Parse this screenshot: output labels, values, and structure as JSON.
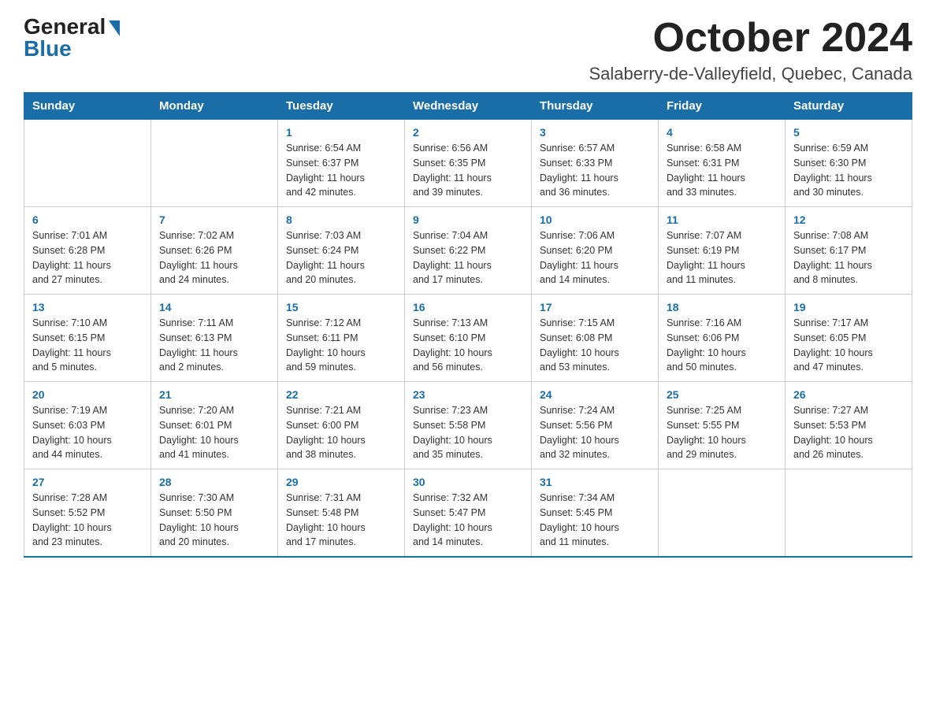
{
  "logo": {
    "general": "General",
    "blue": "Blue"
  },
  "header": {
    "month": "October 2024",
    "location": "Salaberry-de-Valleyfield, Quebec, Canada"
  },
  "weekdays": [
    "Sunday",
    "Monday",
    "Tuesday",
    "Wednesday",
    "Thursday",
    "Friday",
    "Saturday"
  ],
  "weeks": [
    [
      {
        "day": "",
        "info": ""
      },
      {
        "day": "",
        "info": ""
      },
      {
        "day": "1",
        "info": "Sunrise: 6:54 AM\nSunset: 6:37 PM\nDaylight: 11 hours\nand 42 minutes."
      },
      {
        "day": "2",
        "info": "Sunrise: 6:56 AM\nSunset: 6:35 PM\nDaylight: 11 hours\nand 39 minutes."
      },
      {
        "day": "3",
        "info": "Sunrise: 6:57 AM\nSunset: 6:33 PM\nDaylight: 11 hours\nand 36 minutes."
      },
      {
        "day": "4",
        "info": "Sunrise: 6:58 AM\nSunset: 6:31 PM\nDaylight: 11 hours\nand 33 minutes."
      },
      {
        "day": "5",
        "info": "Sunrise: 6:59 AM\nSunset: 6:30 PM\nDaylight: 11 hours\nand 30 minutes."
      }
    ],
    [
      {
        "day": "6",
        "info": "Sunrise: 7:01 AM\nSunset: 6:28 PM\nDaylight: 11 hours\nand 27 minutes."
      },
      {
        "day": "7",
        "info": "Sunrise: 7:02 AM\nSunset: 6:26 PM\nDaylight: 11 hours\nand 24 minutes."
      },
      {
        "day": "8",
        "info": "Sunrise: 7:03 AM\nSunset: 6:24 PM\nDaylight: 11 hours\nand 20 minutes."
      },
      {
        "day": "9",
        "info": "Sunrise: 7:04 AM\nSunset: 6:22 PM\nDaylight: 11 hours\nand 17 minutes."
      },
      {
        "day": "10",
        "info": "Sunrise: 7:06 AM\nSunset: 6:20 PM\nDaylight: 11 hours\nand 14 minutes."
      },
      {
        "day": "11",
        "info": "Sunrise: 7:07 AM\nSunset: 6:19 PM\nDaylight: 11 hours\nand 11 minutes."
      },
      {
        "day": "12",
        "info": "Sunrise: 7:08 AM\nSunset: 6:17 PM\nDaylight: 11 hours\nand 8 minutes."
      }
    ],
    [
      {
        "day": "13",
        "info": "Sunrise: 7:10 AM\nSunset: 6:15 PM\nDaylight: 11 hours\nand 5 minutes."
      },
      {
        "day": "14",
        "info": "Sunrise: 7:11 AM\nSunset: 6:13 PM\nDaylight: 11 hours\nand 2 minutes."
      },
      {
        "day": "15",
        "info": "Sunrise: 7:12 AM\nSunset: 6:11 PM\nDaylight: 10 hours\nand 59 minutes."
      },
      {
        "day": "16",
        "info": "Sunrise: 7:13 AM\nSunset: 6:10 PM\nDaylight: 10 hours\nand 56 minutes."
      },
      {
        "day": "17",
        "info": "Sunrise: 7:15 AM\nSunset: 6:08 PM\nDaylight: 10 hours\nand 53 minutes."
      },
      {
        "day": "18",
        "info": "Sunrise: 7:16 AM\nSunset: 6:06 PM\nDaylight: 10 hours\nand 50 minutes."
      },
      {
        "day": "19",
        "info": "Sunrise: 7:17 AM\nSunset: 6:05 PM\nDaylight: 10 hours\nand 47 minutes."
      }
    ],
    [
      {
        "day": "20",
        "info": "Sunrise: 7:19 AM\nSunset: 6:03 PM\nDaylight: 10 hours\nand 44 minutes."
      },
      {
        "day": "21",
        "info": "Sunrise: 7:20 AM\nSunset: 6:01 PM\nDaylight: 10 hours\nand 41 minutes."
      },
      {
        "day": "22",
        "info": "Sunrise: 7:21 AM\nSunset: 6:00 PM\nDaylight: 10 hours\nand 38 minutes."
      },
      {
        "day": "23",
        "info": "Sunrise: 7:23 AM\nSunset: 5:58 PM\nDaylight: 10 hours\nand 35 minutes."
      },
      {
        "day": "24",
        "info": "Sunrise: 7:24 AM\nSunset: 5:56 PM\nDaylight: 10 hours\nand 32 minutes."
      },
      {
        "day": "25",
        "info": "Sunrise: 7:25 AM\nSunset: 5:55 PM\nDaylight: 10 hours\nand 29 minutes."
      },
      {
        "day": "26",
        "info": "Sunrise: 7:27 AM\nSunset: 5:53 PM\nDaylight: 10 hours\nand 26 minutes."
      }
    ],
    [
      {
        "day": "27",
        "info": "Sunrise: 7:28 AM\nSunset: 5:52 PM\nDaylight: 10 hours\nand 23 minutes."
      },
      {
        "day": "28",
        "info": "Sunrise: 7:30 AM\nSunset: 5:50 PM\nDaylight: 10 hours\nand 20 minutes."
      },
      {
        "day": "29",
        "info": "Sunrise: 7:31 AM\nSunset: 5:48 PM\nDaylight: 10 hours\nand 17 minutes."
      },
      {
        "day": "30",
        "info": "Sunrise: 7:32 AM\nSunset: 5:47 PM\nDaylight: 10 hours\nand 14 minutes."
      },
      {
        "day": "31",
        "info": "Sunrise: 7:34 AM\nSunset: 5:45 PM\nDaylight: 10 hours\nand 11 minutes."
      },
      {
        "day": "",
        "info": ""
      },
      {
        "day": "",
        "info": ""
      }
    ]
  ]
}
